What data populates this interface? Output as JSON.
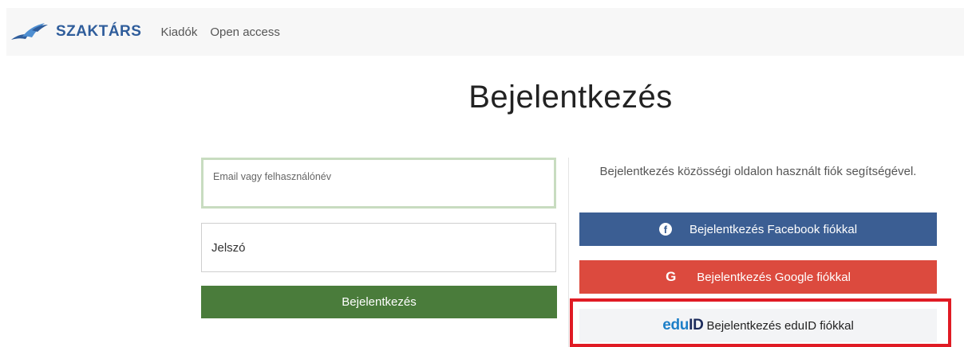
{
  "navbar": {
    "brand": "SZAKTÁRS",
    "links": [
      "Kiadók",
      "Open access"
    ]
  },
  "page": {
    "title": "Bejelentkezés"
  },
  "form": {
    "email_placeholder": "Email vagy felhasználónév",
    "password_placeholder": "Jelszó",
    "submit_label": "Bejelentkezés"
  },
  "social": {
    "intro": "Bejelentkezés közösségi oldalon használt fiók segítségével.",
    "facebook_label": "Bejelentkezés Facebook fiókkal",
    "google_label": "Bejelentkezés Google fiókkal",
    "google_icon_letter": "G",
    "eduid_logo_edu": "edu",
    "eduid_logo_id": "ID",
    "eduid_label": "Bejelentkezés eduID fiókkal"
  },
  "colors": {
    "brand_blue": "#2f5d9b",
    "login_green": "#4a7c3b",
    "facebook_blue": "#3b5e93",
    "google_red": "#dc4a3e",
    "highlight_red": "#e01b24"
  }
}
